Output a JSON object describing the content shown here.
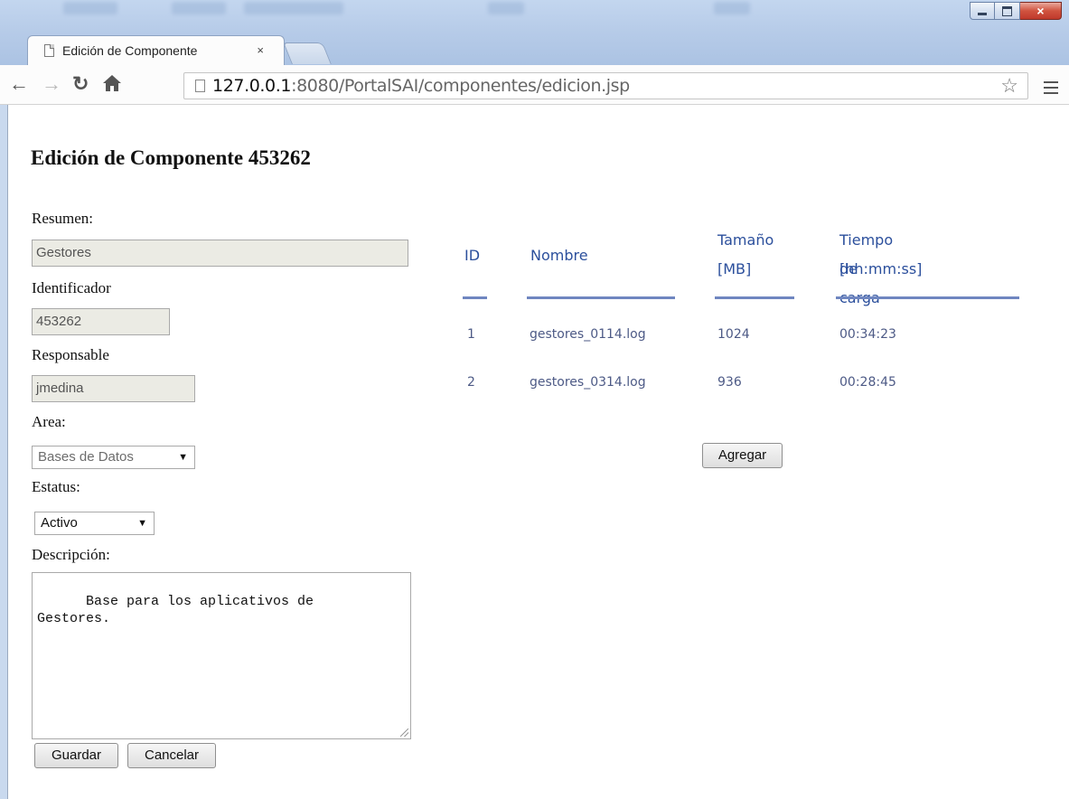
{
  "browser": {
    "tab_title": "Edición de Componente",
    "tab_close": "×",
    "url_host": "127.0.0.1",
    "url_path": ":8080/PortalSAI/componentes/edicion.jsp",
    "window_buttons": {
      "minimize": "minimize",
      "maximize": "maximize",
      "close": "×"
    }
  },
  "page": {
    "title": "Edición de Componente 453262"
  },
  "form": {
    "resumen_label": "Resumen:",
    "resumen_value": "Gestores",
    "identificador_label": "Identificador",
    "identificador_value": "453262",
    "responsable_label": "Responsable",
    "responsable_value": "jmedina",
    "area_label": "Area:",
    "area_selected": "Bases de Datos",
    "estatus_label": "Estatus:",
    "estatus_selected": "Activo",
    "descripcion_label": "Descripción:",
    "descripcion_value": "Base para los aplicativos de\nGestores.",
    "guardar_label": "Guardar",
    "cancelar_label": "Cancelar"
  },
  "table": {
    "columns": [
      {
        "line1": "ID",
        "line2": ""
      },
      {
        "line1": "Nombre",
        "line2": ""
      },
      {
        "line1": "Tamaño",
        "line2": "[MB]"
      },
      {
        "line1": "Tiempo de carga",
        "line2": "[hh:mm:ss]"
      }
    ],
    "rows": [
      {
        "id": "1",
        "nombre": "gestores_0114.log",
        "tamano": "1024",
        "tiempo": "00:34:23"
      },
      {
        "id": "2",
        "nombre": "gestores_0314.log",
        "tamano": "936",
        "tiempo": "00:28:45"
      }
    ],
    "agregar_label": "Agregar"
  },
  "colors": {
    "header_text": "#2b4f9c",
    "header_rule": "#6f86c0",
    "cell_text": "#4d5a86"
  }
}
